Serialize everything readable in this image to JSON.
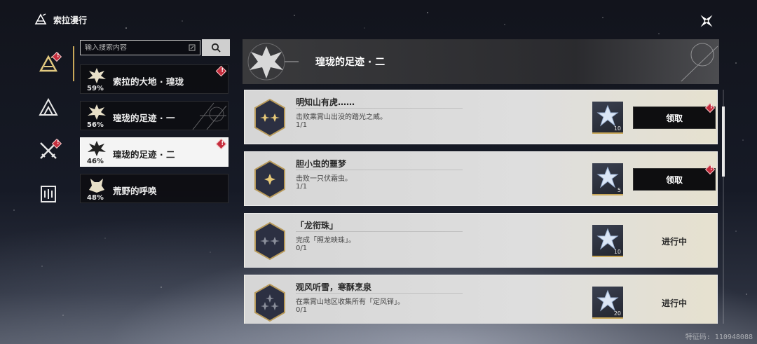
{
  "app": {
    "title": "索拉漫行"
  },
  "search": {
    "placeholder": "输入搜索内容"
  },
  "rail": [
    {
      "icon": "sola-logo-icon",
      "active": true,
      "badge": true
    },
    {
      "icon": "mountain-icon",
      "active": false,
      "badge": false
    },
    {
      "icon": "crossed-swords-icon",
      "active": false,
      "badge": true
    },
    {
      "icon": "journal-icon",
      "active": false,
      "badge": false
    }
  ],
  "categories": [
    {
      "label": "索拉的大地 · 瑝珑",
      "percent": "59%",
      "badge": true,
      "selected": false
    },
    {
      "label": "瑝珑的足迹 · 一",
      "percent": "56%",
      "badge": false,
      "selected": false
    },
    {
      "label": "瑝珑的足迹 · 二",
      "percent": "46%",
      "badge": true,
      "selected": true
    },
    {
      "label": "荒野的呼唤",
      "percent": "48%",
      "badge": false,
      "selected": false
    }
  ],
  "panel": {
    "title": "瑝珑的足迹 · 二"
  },
  "tasks": [
    {
      "title": "明知山有虎……",
      "desc": "击败乘霄山出没的踏光之威。",
      "progress": "1/1",
      "reward_count": "10",
      "action": "领取",
      "claimable": true,
      "stars": 2
    },
    {
      "title": "胆小虫的噩梦",
      "desc": "击败一只伏霜虫。",
      "progress": "1/1",
      "reward_count": "5",
      "action": "领取",
      "claimable": true,
      "stars": 1
    },
    {
      "title": "「龙衔珠」",
      "desc": "完成「照龙映珠」。",
      "progress": "0/1",
      "reward_count": "10",
      "action": "进行中",
      "claimable": false,
      "stars": 2
    },
    {
      "title": "观风听雪，寒酥烹泉",
      "desc": "在乘霄山地区收集所有「定风铎」。",
      "progress": "0/1",
      "reward_count": "20",
      "action": "进行中",
      "claimable": false,
      "stars": 3
    }
  ],
  "footer": {
    "uid": "特征码: 110948088"
  },
  "colors": {
    "accent_gold": "#c9a85a",
    "badge_red": "#c42c3c",
    "claim_bg": "#0e0e10"
  }
}
